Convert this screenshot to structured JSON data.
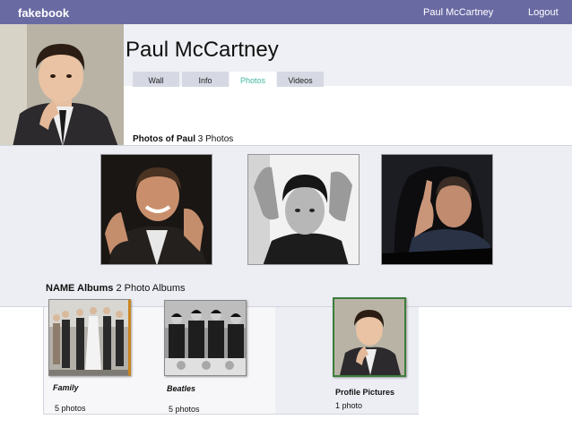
{
  "topbar": {
    "brand": "fakebook",
    "user_name": "Paul McCartney",
    "logout": "Logout"
  },
  "profile": {
    "name": "Paul McCartney"
  },
  "tabs": [
    {
      "label": "Wall",
      "active": false
    },
    {
      "label": "Info",
      "active": false
    },
    {
      "label": "Photos",
      "active": true
    },
    {
      "label": "Videos",
      "active": false
    }
  ],
  "photos_section": {
    "title": "Photos of Paul",
    "count": "3 Photos"
  },
  "albums_section": {
    "title": "NAME Albums",
    "count": "2 Photo Albums",
    "albums": [
      {
        "name": "Family",
        "count": "5 photos"
      },
      {
        "name": "Beatles",
        "count": "5 photos"
      },
      {
        "name": "Profile Pictures",
        "count": "1 photo"
      }
    ]
  },
  "colors": {
    "topbar": "#6a6aa3",
    "active_tab_text": "#3fb7a0",
    "band": "#eceef4"
  }
}
